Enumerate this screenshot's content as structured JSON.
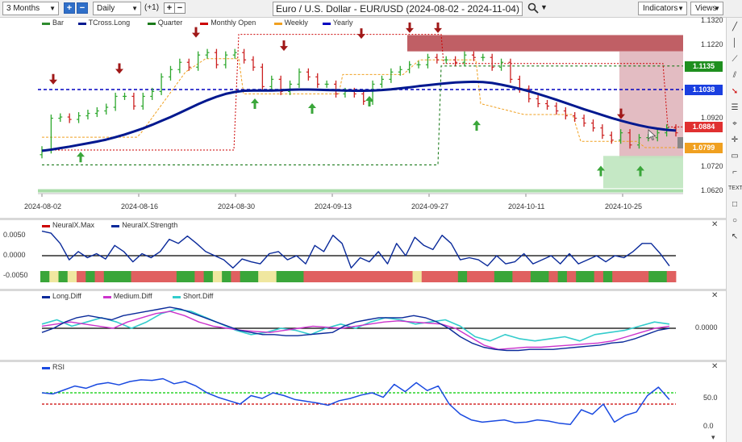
{
  "toolbar": {
    "period": "3 Months",
    "interval": "Daily",
    "offset": "(+1)",
    "plus": "+",
    "minus": "−",
    "title": "Euro / U.S. Dollar - EUR/USD (2024-08-02 - 2024-11-04)",
    "indicators": "Indicators",
    "views": "Views"
  },
  "main": {
    "legend": [
      {
        "label": "Bar",
        "color": "#2e8b2e"
      },
      {
        "label": "TCross.Long",
        "color": "#00188f"
      },
      {
        "label": "Quarter",
        "color": "#1a7a1a"
      },
      {
        "label": "Monthly Open",
        "color": "#cc0000"
      },
      {
        "label": "Weekly",
        "color": "#f0a020"
      },
      {
        "label": "Yearly",
        "color": "#0000c0"
      }
    ],
    "y_ticks": [
      "1.1320",
      "1.1220",
      "1.0920",
      "1.0720",
      "1.0620"
    ],
    "x_ticks": [
      "2024-08-02",
      "2024-08-16",
      "2024-08-30",
      "2024-09-13",
      "2024-09-27",
      "2024-10-11",
      "2024-10-25"
    ],
    "tags": [
      {
        "value": "1.1135",
        "color": "#1f8f1f"
      },
      {
        "value": "1.1038",
        "color": "#1a3fe0"
      },
      {
        "value": "1.0884",
        "color": "#e03030"
      },
      {
        "value": "1.0799",
        "color": "#f0a020"
      }
    ]
  },
  "neural": {
    "legend": [
      {
        "label": "NeuralX.Max",
        "color": "#cc0000"
      },
      {
        "label": "NeuralX.Strength",
        "color": "#0a2a9a"
      }
    ],
    "y_ticks": [
      "0.0050",
      "0.0000",
      "-0.0050"
    ]
  },
  "diff": {
    "legend": [
      {
        "label": "Long.Diff",
        "color": "#0a2a9a"
      },
      {
        "label": "Medium.Diff",
        "color": "#cc33cc"
      },
      {
        "label": "Short.Diff",
        "color": "#33cccc"
      }
    ],
    "y_ticks": [
      "0.0000"
    ]
  },
  "rsi": {
    "legend": [
      {
        "label": "RSI",
        "color": "#1a4ae0"
      }
    ],
    "y_ticks": [
      "50.0",
      "0.0"
    ]
  },
  "chart_data": [
    {
      "type": "line",
      "title": "Euro / U.S. Dollar - EUR/USD (2024-08-02 - 2024-11-04)",
      "x_range": [
        "2024-08-02",
        "2024-11-04"
      ],
      "ylim": [
        1.062,
        1.132
      ],
      "series": [
        {
          "name": "TCross.Long",
          "color": "#00188f",
          "values": [
            1.0786,
            1.0791,
            1.0797,
            1.0803,
            1.081,
            1.0817,
            1.0824,
            1.0832,
            1.0842,
            1.0853,
            1.0865,
            1.0878,
            1.0893,
            1.0909,
            1.0925,
            1.0942,
            1.096,
            1.0978,
            1.0994,
            1.1008,
            1.102,
            1.1028,
            1.1033,
            1.1034,
            1.1034,
            1.1034,
            1.1035,
            1.1037,
            1.1038,
            1.1038,
            1.1037,
            1.1036,
            1.1035,
            1.1034,
            1.1033,
            1.1033,
            1.1034,
            1.1036,
            1.1039,
            1.1043,
            1.1047,
            1.1052,
            1.1056,
            1.106,
            1.1064,
            1.1067,
            1.1069,
            1.107,
            1.1069,
            1.1065,
            1.1058,
            1.105,
            1.1041,
            1.1031,
            1.102,
            1.1008,
            1.0996,
            1.0983,
            1.097,
            1.0957,
            1.0945,
            1.0933,
            1.0921,
            1.091,
            1.09,
            1.0891,
            1.0883,
            1.0877,
            1.0872,
            1.0869
          ]
        }
      ],
      "levels": [
        {
          "name": "Yearly",
          "value": 1.1038,
          "color": "#0000c0"
        },
        {
          "name": "Quarter",
          "value": 1.1135,
          "color": "#1a7a1a"
        },
        {
          "name": "Weekly",
          "value": 1.0799,
          "color": "#f0a020"
        },
        {
          "name": "Monthly Open",
          "value": 1.0884,
          "color": "#cc0000"
        }
      ]
    },
    {
      "type": "line",
      "title": "NeuralX.Strength",
      "ylim": [
        -0.0075,
        0.0075
      ],
      "series": [
        {
          "name": "NeuralX.Strength",
          "color": "#0a2a9a",
          "values": [
            0.006,
            0.0055,
            0.003,
            -0.001,
            0.001,
            -0.0005,
            0.0005,
            -0.0008,
            0.0025,
            0.001,
            -0.0015,
            0.0005,
            -0.0005,
            0.001,
            0.004,
            0.003,
            0.0048,
            0.003,
            0.001,
            0.0,
            -0.001,
            -0.003,
            -0.0008,
            -0.0015,
            -0.002,
            0.0005,
            0.001,
            -0.001,
            0.0,
            -0.002,
            0.0025,
            0.001,
            0.005,
            0.003,
            -0.003,
            -0.0005,
            -0.0015,
            0.001,
            -0.002,
            0.003,
            0.0,
            0.0045,
            0.0025,
            0.0015,
            0.005,
            0.003,
            -0.001,
            -0.0005,
            -0.001,
            -0.0025,
            0.0,
            -0.002,
            -0.0015,
            0.0005,
            -0.002,
            -0.001,
            0.0,
            -0.002,
            0.0005,
            -0.002,
            -0.001,
            0.0,
            -0.0015,
            0.0,
            -0.0005,
            0.001,
            0.003,
            0.003,
            0.0005,
            -0.0025
          ]
        }
      ]
    },
    {
      "type": "line",
      "title": "Long.Diff / Medium.Diff / Short.Diff",
      "ylim": [
        -1.3,
        1.3
      ],
      "series": [
        {
          "name": "Long.Diff",
          "color": "#0a2a9a",
          "values": [
            -0.2,
            0.0,
            0.3,
            0.5,
            0.6,
            0.5,
            0.4,
            0.6,
            0.7,
            0.8,
            0.9,
            1.0,
            0.9,
            0.7,
            0.5,
            0.3,
            0.1,
            -0.1,
            -0.2,
            -0.3,
            -0.3,
            -0.35,
            -0.35,
            -0.3,
            -0.25,
            -0.2,
            0.1,
            0.3,
            0.4,
            0.5,
            0.5,
            0.5,
            0.6,
            0.5,
            0.3,
            0.0,
            -0.4,
            -0.7,
            -0.9,
            -1.0,
            -1.05,
            -1.05,
            -1.0,
            -1.0,
            -1.0,
            -0.95,
            -0.9,
            -0.85,
            -0.8,
            -0.7,
            -0.65,
            -0.5,
            -0.3,
            -0.1,
            0.0
          ]
        },
        {
          "name": "Medium.Diff",
          "color": "#cc33cc",
          "values": [
            0.1,
            0.2,
            0.3,
            0.2,
            0.1,
            0.0,
            0.3,
            0.5,
            0.7,
            0.8,
            0.6,
            0.3,
            0.1,
            0.0,
            -0.1,
            -0.15,
            -0.2,
            -0.1,
            0.0,
            0.1,
            0.05,
            0.0,
            0.1,
            0.2,
            0.3,
            0.35,
            0.3,
            0.25,
            0.2,
            0.0,
            -0.4,
            -0.8,
            -1.0,
            -0.95,
            -0.9,
            -0.9,
            -0.85,
            -0.8,
            -0.75,
            -0.7,
            -0.6,
            -0.4,
            -0.2,
            0.0,
            0.1
          ]
        },
        {
          "name": "Short.Diff",
          "color": "#33cccc",
          "values": [
            0.2,
            0.4,
            0.1,
            0.3,
            0.5,
            0.3,
            0.0,
            0.3,
            0.7,
            0.9,
            0.8,
            0.5,
            0.2,
            -0.1,
            -0.3,
            -0.2,
            0.0,
            -0.1,
            -0.3,
            0.0,
            0.2,
            0.0,
            0.3,
            0.5,
            0.4,
            0.2,
            0.3,
            0.4,
            0.1,
            -0.4,
            -0.6,
            -0.3,
            -0.5,
            -0.6,
            -0.5,
            -0.4,
            -0.6,
            -0.3,
            -0.2,
            -0.1,
            0.1,
            0.3,
            0.2
          ]
        }
      ]
    },
    {
      "type": "line",
      "title": "RSI",
      "ylim": [
        0,
        100
      ],
      "series": [
        {
          "name": "RSI",
          "color": "#1a4ae0",
          "values": [
            60,
            58,
            65,
            72,
            68,
            75,
            78,
            74,
            80,
            83,
            82,
            85,
            76,
            80,
            72,
            60,
            52,
            46,
            40,
            55,
            50,
            60,
            55,
            48,
            45,
            42,
            38,
            46,
            50,
            56,
            60,
            52,
            75,
            62,
            78,
            64,
            72,
            40,
            22,
            12,
            8,
            10,
            12,
            7,
            8,
            12,
            10,
            6,
            4,
            30,
            22,
            40,
            8,
            20,
            26,
            55,
            70,
            48
          ]
        }
      ],
      "levels": [
        {
          "value": 60,
          "color": "#00cc00"
        },
        {
          "value": 40,
          "color": "#cc0000"
        }
      ]
    }
  ]
}
